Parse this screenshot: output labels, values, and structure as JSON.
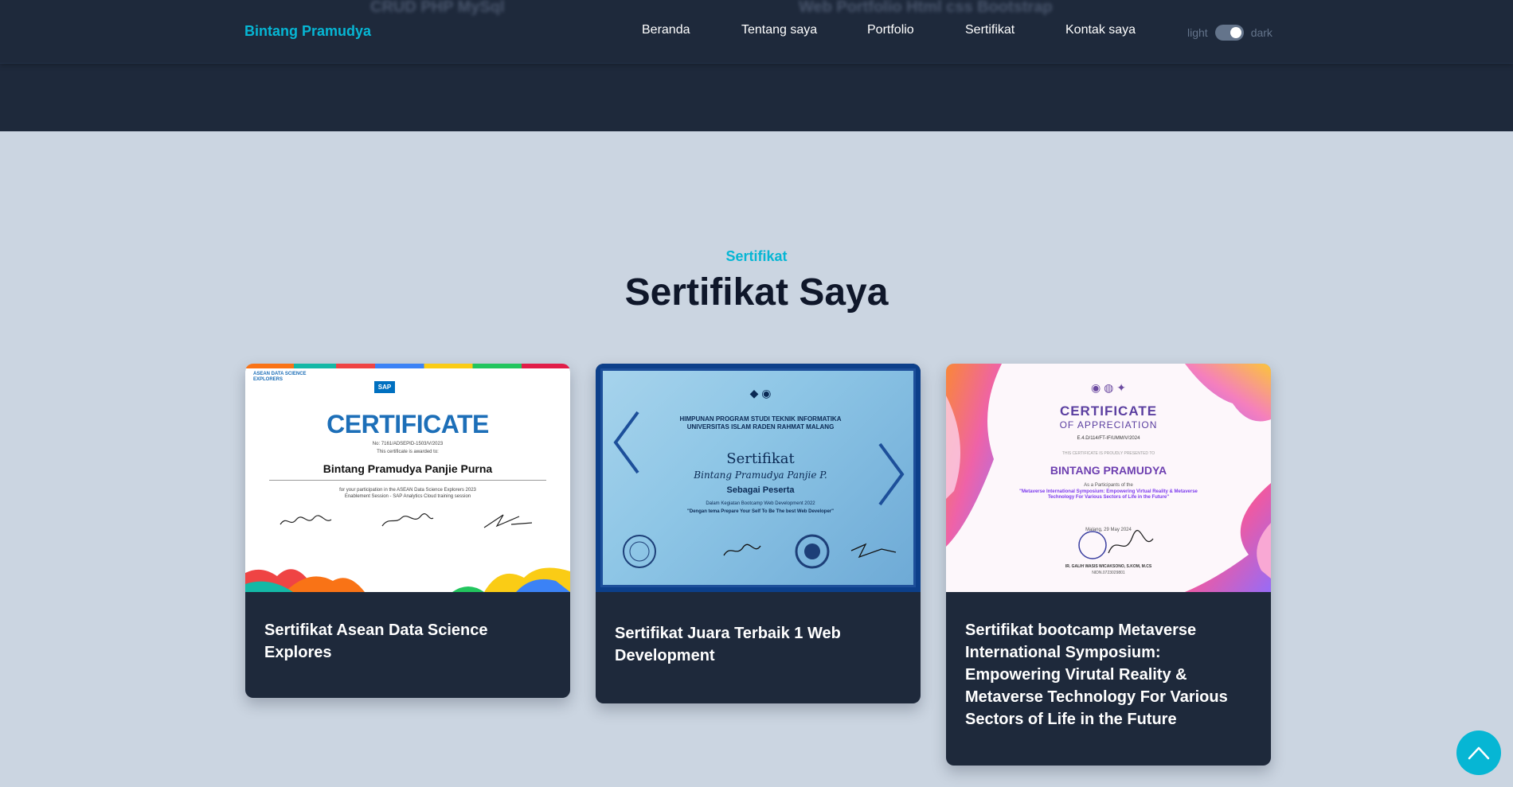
{
  "ghost_titles": [
    "CRUD PHP MySql",
    "Web Portfolio Html css Bootstrap"
  ],
  "brand": "Bintang Pramudya",
  "nav": [
    "Beranda",
    "Tentang saya",
    "Portfolio",
    "Sertifikat",
    "Kontak saya"
  ],
  "theme": {
    "light_label": "light",
    "dark_label": "dark",
    "dark_on": true
  },
  "section": {
    "subtitle": "Sertifikat",
    "title": "Sertifikat Saya"
  },
  "cards": [
    {
      "caption": "Sertifikat Asean Data Science Explores",
      "image_text": {
        "org": "ASEAN DATA SCIENCE EXPLORERS",
        "sap": "SAP",
        "heading": "CERTIFICATE",
        "number": "No: 7161/ADSEPID-1503/V/2023",
        "awarded": "This certificate is awarded to:",
        "name": "Bintang Pramudya Panjie Purna",
        "reason": "for your participation in the ASEAN Data Science Explorers 2023",
        "session": "Enablement Session - SAP Analytics Cloud training session"
      }
    },
    {
      "caption": "Sertifikat Juara Terbaik 1 Web Development",
      "image_text": {
        "h1": "HIMPUNAN PROGRAM STUDI TEKNIK INFORMATIKA",
        "h2": "UNIVERSITAS ISLAM RADEN RAHMAT MALANG",
        "title": "Sertifikat",
        "name": "Bintang Pramudya Panjie P.",
        "role": "Sebagai Peserta",
        "desc": "Dalam Kegiatan Bootcamp Web Development 2022",
        "motto": "\"Dengan tema Prepare Your Self To Be The best Web Developer\""
      }
    },
    {
      "caption": "Sertifikat bootcamp Metaverse International Symposium: Empowering Virutal Reality & Metaverse Technology For Various Sectors of Life in the Future",
      "image_text": {
        "heading": "CERTIFICATE",
        "sub": "OF APPRECIATION",
        "number": "E.4.D/114/FT-IF/UMM/V/2024",
        "presented": "THIS CERTIFICATE IS PROUDLY PRESENTED TO",
        "name": "BINTANG PRAMUDYA",
        "as": "As a Participants of the",
        "event": "\"Metaverse International Symposium: Empowering Virtual Reality & Metaverse Technology For Various Sectors of Life in the Future\"",
        "date": "Malang, 29 May 2024",
        "signer": "IR. GALIH WASIS WICAKSONO, S.KOM, M.CS",
        "nidn": "NIDN.0723029801"
      }
    }
  ],
  "colors": {
    "navbar_bg": "#1e293b",
    "page_bg": "#cbd5e1",
    "accent": "#06b6d4",
    "title": "#0f172a"
  },
  "icons": {
    "scroll_top": "chevron-up-icon"
  }
}
